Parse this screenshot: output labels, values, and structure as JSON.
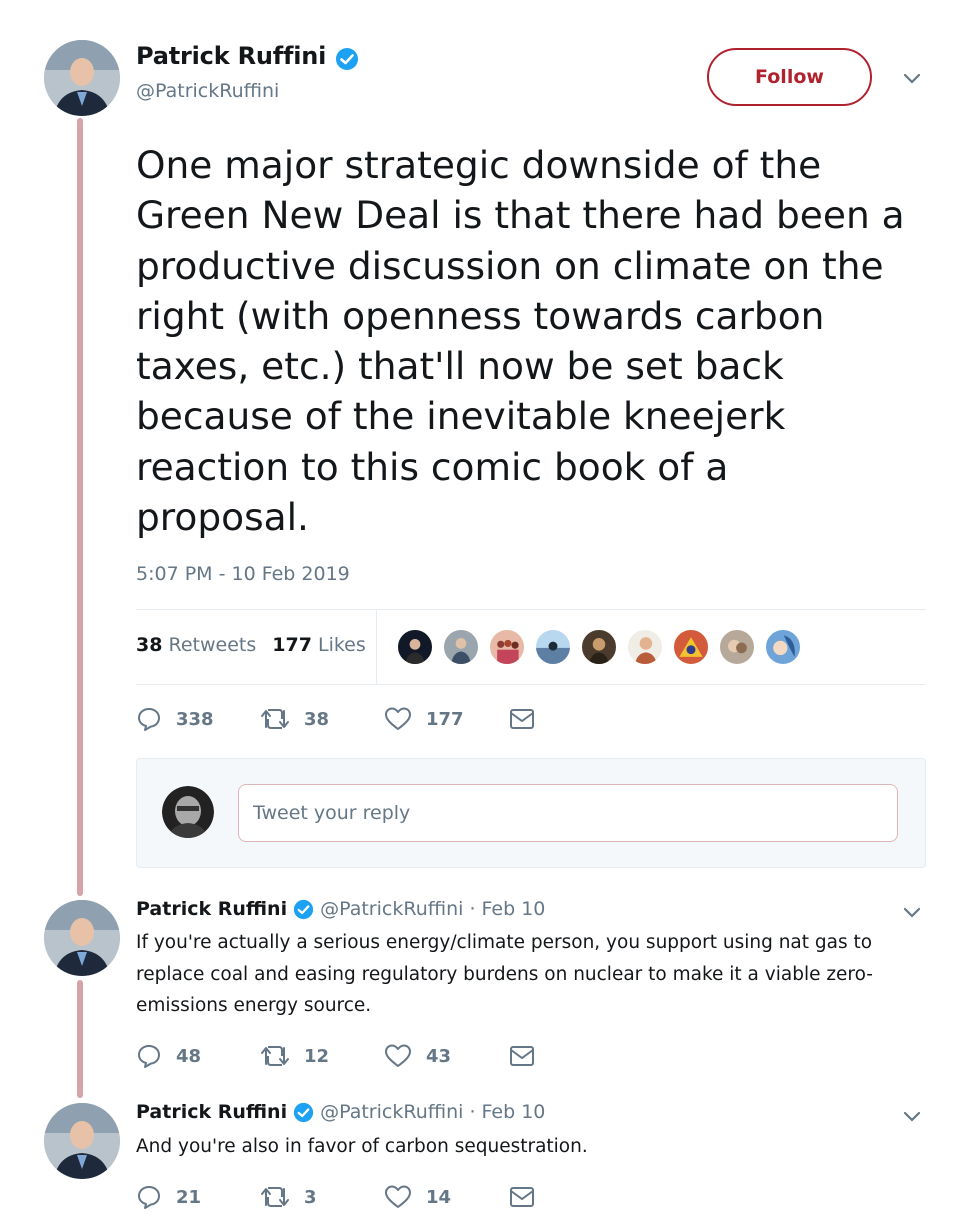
{
  "main_tweet": {
    "author_name": "Patrick Ruffini",
    "author_handle": "@PatrickRuffini",
    "follow_label": "Follow",
    "text": "One major strategic downside of the\nGreen New Deal is that there had been a\nproductive discussion on climate on the\nright (with openness towards carbon\ntaxes, etc.) that'll now be set back\nbecause of the inevitable kneejerk\nreaction to this comic book of a\nproposal.",
    "timestamp": "5:07 PM - 10 Feb 2019",
    "retweet_count": "38",
    "retweet_label": "Retweets",
    "like_count": "177",
    "like_label": "Likes",
    "actions": {
      "replies": "338",
      "retweets": "38",
      "likes": "177"
    }
  },
  "reply_box": {
    "placeholder": "Tweet your reply"
  },
  "replies": [
    {
      "author_name": "Patrick Ruffini",
      "author_handle": "@PatrickRuffini",
      "date": "· Feb 10",
      "text": "If you're actually a serious energy/climate person, you support using nat gas to replace coal and easing regulatory burdens on nuclear to make it a viable zero-emissions energy source.",
      "actions": {
        "replies": "48",
        "retweets": "12",
        "likes": "43"
      }
    },
    {
      "author_name": "Patrick Ruffini",
      "author_handle": "@PatrickRuffini",
      "date": "· Feb 10",
      "text": "And you're also in favor of carbon sequestration.",
      "actions": {
        "replies": "21",
        "retweets": "3",
        "likes": "14"
      }
    }
  ],
  "colors": {
    "follow_accent": "#b1222f",
    "verified": "#1da1f2",
    "thread_line": "#d6a3a7",
    "secondary_text": "#657786"
  },
  "icons": {
    "verified": "verified-badge-icon",
    "caret": "chevron-down-icon",
    "reply": "reply-icon",
    "retweet": "retweet-icon",
    "like": "heart-icon",
    "dm": "envelope-icon"
  }
}
